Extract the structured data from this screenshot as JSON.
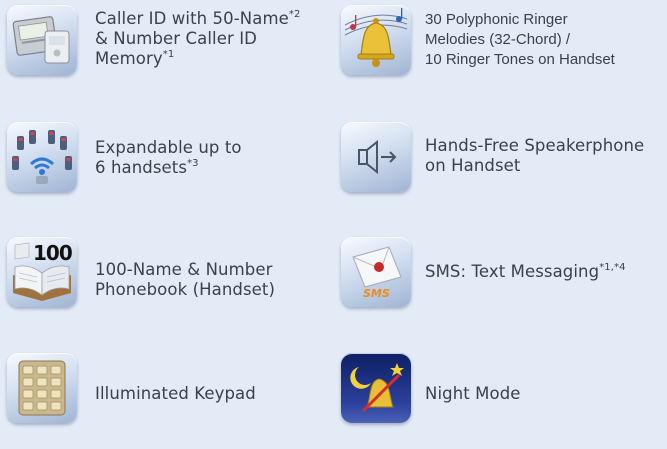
{
  "features": [
    {
      "id": "caller-id",
      "icon": "caller-id-icon",
      "lines": [
        {
          "text": "Caller ID with 50-Name",
          "sup": "*2"
        },
        {
          "text": "& Number Caller ID",
          "sup": ""
        },
        {
          "text": "Memory",
          "sup": "*1"
        }
      ]
    },
    {
      "id": "ringer-melodies",
      "icon": "bell-icon",
      "lines": [
        {
          "text": "30 Polyphonic Ringer",
          "sup": ""
        },
        {
          "text": "Melodies (32-Chord) /",
          "sup": ""
        },
        {
          "text": "10 Ringer Tones on Handset",
          "sup": ""
        }
      ]
    },
    {
      "id": "expandable-handsets",
      "icon": "handsets-network-icon",
      "lines": [
        {
          "text": "Expandable up to",
          "sup": ""
        },
        {
          "text": "6 handsets",
          "sup": "*3"
        }
      ]
    },
    {
      "id": "speakerphone",
      "icon": "speaker-icon",
      "lines": [
        {
          "text": "Hands-Free Speakerphone",
          "sup": ""
        },
        {
          "text": "on Handset",
          "sup": ""
        }
      ]
    },
    {
      "id": "phonebook",
      "icon": "phonebook-icon",
      "badge": "100",
      "lines": [
        {
          "text": "100-Name & Number",
          "sup": ""
        },
        {
          "text": "Phonebook (Handset)",
          "sup": ""
        }
      ]
    },
    {
      "id": "sms",
      "icon": "envelope-icon",
      "badge": "SMS",
      "lines": [
        {
          "text": "SMS: Text Messaging",
          "sup": "*1,*4"
        }
      ]
    },
    {
      "id": "keypad",
      "icon": "keypad-icon",
      "lines": [
        {
          "text": "Illuminated Keypad",
          "sup": ""
        }
      ]
    },
    {
      "id": "night-mode",
      "icon": "night-bell-icon",
      "lines": [
        {
          "text": "Night Mode",
          "sup": ""
        }
      ]
    }
  ],
  "colors": {
    "background": "#e3ebf7",
    "text": "#3b4149",
    "icon_light": "#f7faff",
    "icon_dark": "#9fb4d3"
  }
}
